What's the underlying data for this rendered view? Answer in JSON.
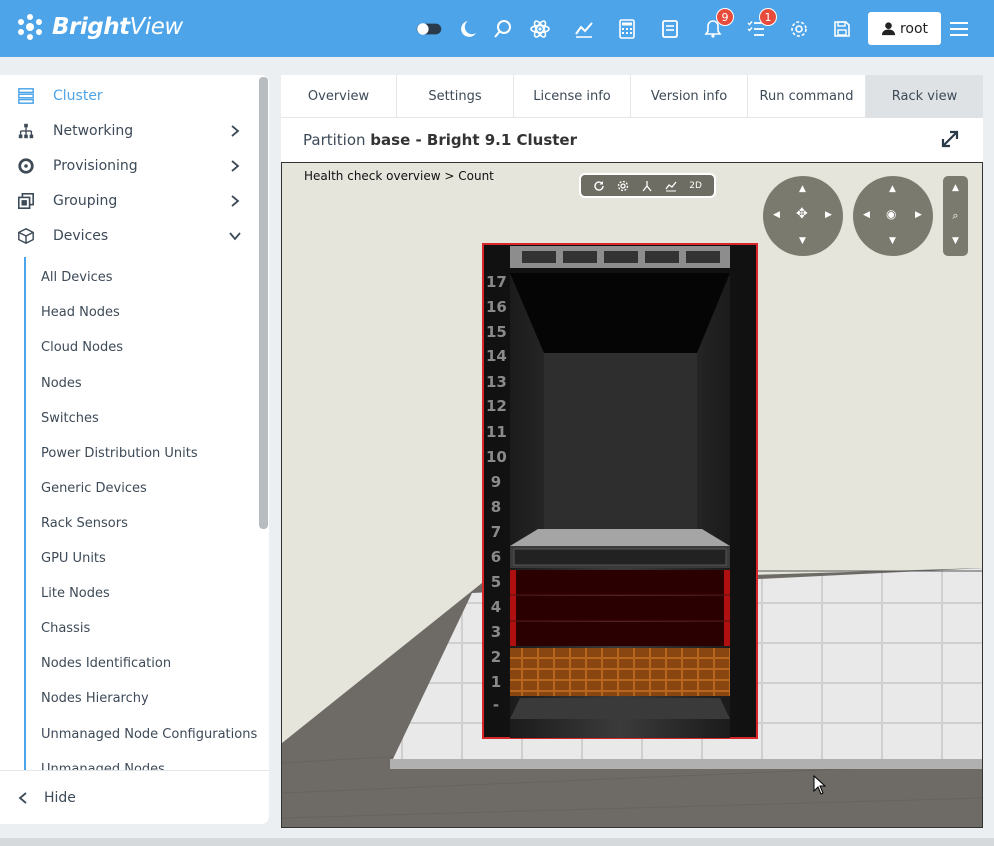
{
  "app": {
    "brand_bold": "Bright",
    "brand_light": "View"
  },
  "topbar": {
    "notifications_count": "9",
    "tasks_count": "1",
    "user_label": "root"
  },
  "sidebar": {
    "items": [
      {
        "label": "Cluster"
      },
      {
        "label": "Networking"
      },
      {
        "label": "Provisioning"
      },
      {
        "label": "Grouping"
      },
      {
        "label": "Devices"
      }
    ],
    "subitems": [
      "All Devices",
      "Head Nodes",
      "Cloud Nodes",
      "Nodes",
      "Switches",
      "Power Distribution Units",
      "Generic Devices",
      "Rack Sensors",
      "GPU Units",
      "Lite Nodes",
      "Chassis",
      "Nodes Identification",
      "Nodes Hierarchy",
      "Unmanaged Node Configurations",
      "Unmanaged Nodes"
    ],
    "hide_label": "Hide"
  },
  "tabs": [
    "Overview",
    "Settings",
    "License info",
    "Version info",
    "Run command",
    "Rack view"
  ],
  "partition": {
    "prefix": "Partition",
    "name": "base - Bright 9.1 Cluster"
  },
  "viewport": {
    "health_label": "Health check overview > Count",
    "toolbar_2d": "2D",
    "rack_units": [
      "17",
      "16",
      "15",
      "14",
      "13",
      "12",
      "11",
      "10",
      "9",
      "8",
      "7",
      "6",
      "5",
      "4",
      "3",
      "2",
      "1",
      "-"
    ]
  },
  "colors": {
    "accent": "#4da4e8",
    "badge": "#e64b3c",
    "rack_border": "#d9262b"
  }
}
